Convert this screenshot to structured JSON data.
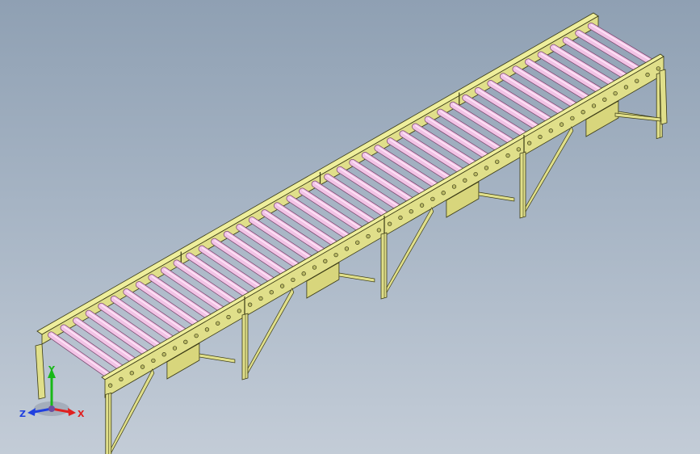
{
  "viewport": {
    "name": "3d-graphics-area",
    "background_top": "#8fa0b3",
    "background_bottom": "#c3ccd7"
  },
  "model": {
    "name": "roller-conveyor-assembly",
    "sections": 4,
    "frame_color": "#e0df8a",
    "frame_edge_color": "#3a3a14",
    "roller_color": "#f2c3e6",
    "roller_edge_color": "#7a4a70"
  },
  "triad": {
    "x_label": "X",
    "y_label": "Y",
    "z_label": "Z",
    "x_color": "#e02020",
    "y_color": "#18b818",
    "z_color": "#2040e0"
  }
}
